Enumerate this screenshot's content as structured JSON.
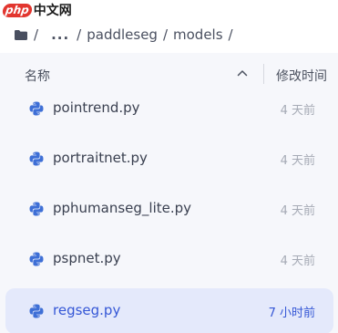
{
  "watermark": {
    "php": "php",
    "cn": "中文网"
  },
  "breadcrumb": {
    "root_sep": "/",
    "ellipsis": "...",
    "items": [
      {
        "label": "paddleseg",
        "sep": "/"
      },
      {
        "label": "models",
        "sep": "/"
      }
    ]
  },
  "header": {
    "name_label": "名称",
    "time_label": "修改时间"
  },
  "files": [
    {
      "name": "pointrend.py",
      "time": "4 天前",
      "selected": false
    },
    {
      "name": "portraitnet.py",
      "time": "4 天前",
      "selected": false
    },
    {
      "name": "pphumanseg_lite.py",
      "time": "4 天前",
      "selected": false
    },
    {
      "name": "pspnet.py",
      "time": "4 天前",
      "selected": false
    },
    {
      "name": "regseg.py",
      "time": "7 小时前",
      "selected": true
    }
  ],
  "colors": {
    "accent": "#3557d6",
    "selected_bg": "#e4e9fb",
    "panel_bg": "#f6f7fb",
    "python_icon": "#3e6fd6"
  },
  "icons": {
    "breadcrumb_root": "folder-icon",
    "file": "python-file-icon",
    "sort": "chevron-up-icon"
  }
}
